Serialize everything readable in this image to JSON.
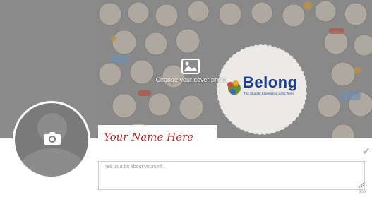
{
  "cover": {
    "change_label": "Change your cover photo",
    "icon": "image-icon"
  },
  "logo": {
    "word": "Belong",
    "tagline": "The Student Experience Long Term"
  },
  "profile": {
    "avatar_icon": "camera-icon",
    "name_placeholder": "Your Name Here"
  },
  "about": {
    "placeholder": "Tell us a bit about yourself...",
    "char_limit": "300"
  },
  "colors": {
    "name_red": "#b52a2a",
    "logo_blue": "#1d3f8f"
  }
}
